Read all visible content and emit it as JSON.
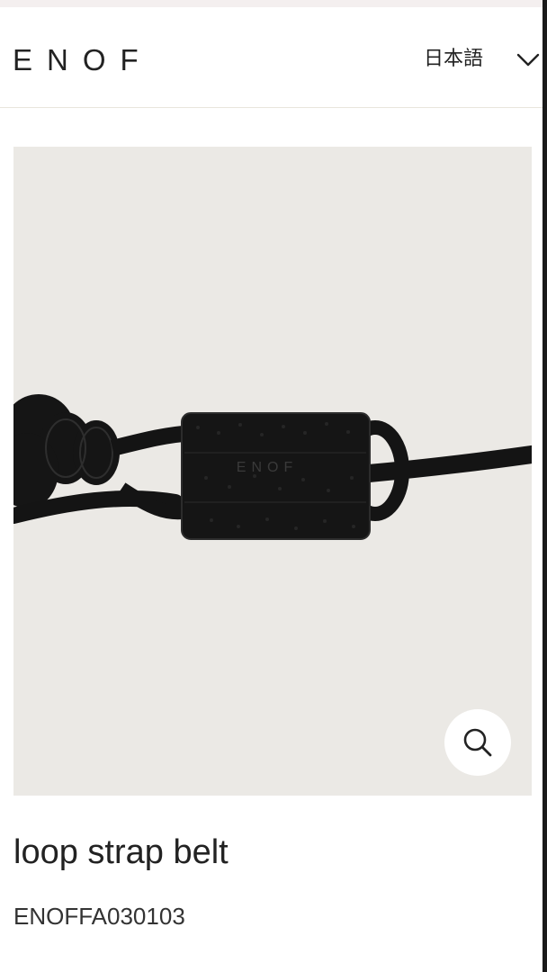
{
  "header": {
    "logo": "ENOF",
    "language": "日本語"
  },
  "product": {
    "image_alt": "loop strap belt",
    "embossed_mark": "ENOF",
    "name": "loop strap belt",
    "sku": "ENOFFA030103"
  },
  "icons": {
    "language_toggle": "chevron-down-icon",
    "zoom": "search-icon"
  },
  "colors": {
    "image_background": "#ebe9e5",
    "leather": "#141414",
    "text": "#222222"
  }
}
